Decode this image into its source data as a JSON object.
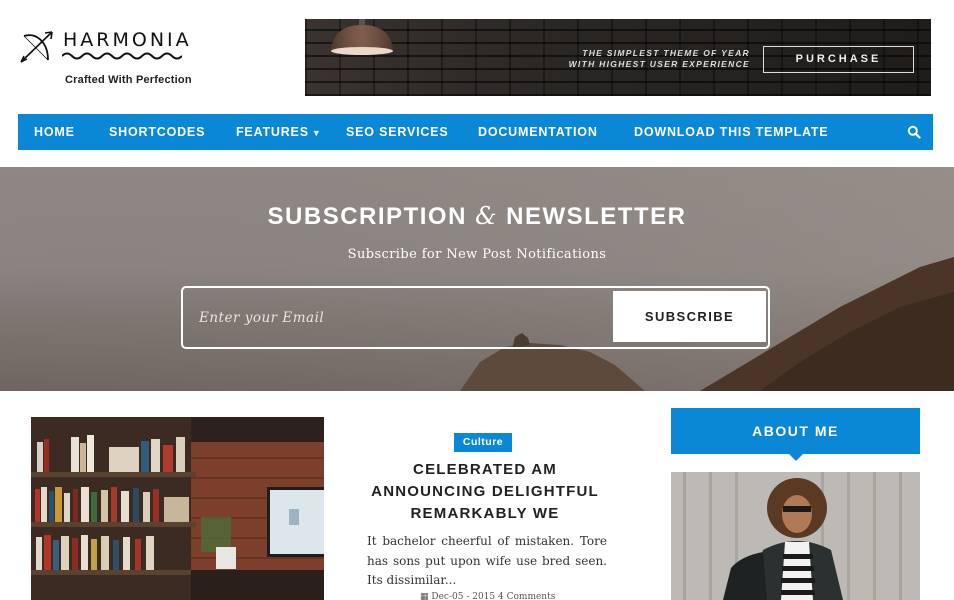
{
  "header": {
    "logo_text": "HARMONIA",
    "tagline": "Crafted With Perfection"
  },
  "banner": {
    "line1": "THE SIMPLEST THEME OF YEAR",
    "line2": "WITH HIGHEST USER EXPERIENCE",
    "button_label": "PURCHASE"
  },
  "nav": {
    "items": [
      "HOME",
      "SHORTCODES",
      "FEATURES",
      "SEO SERVICES",
      "DOCUMENTATION",
      "DOWNLOAD THIS TEMPLATE"
    ],
    "caret": "▼",
    "search_icon": "search-icon"
  },
  "hero": {
    "title_left": "SUBSCRIPTION",
    "title_amp": "&",
    "title_right": "NEWSLETTER",
    "subtitle": "Subscribe for New Post Notifications",
    "email_placeholder": "Enter your Email",
    "subscribe_label": "SUBSCRIBE"
  },
  "post": {
    "category": "Culture",
    "title": "CELEBRATED AM ANNOUNCING DELIGHTFUL REMARKABLY WE",
    "excerpt": "It bachelor cheerful of mistaken. Tore has sons put upon wife use bred seen. Its dissimilar...",
    "date": "Dec-05 - 2015",
    "comments": "4 Comments"
  },
  "sidebar": {
    "about_title": "ABOUT ME"
  },
  "colors": {
    "accent": "#0a88d5",
    "text_dark": "#222222"
  }
}
